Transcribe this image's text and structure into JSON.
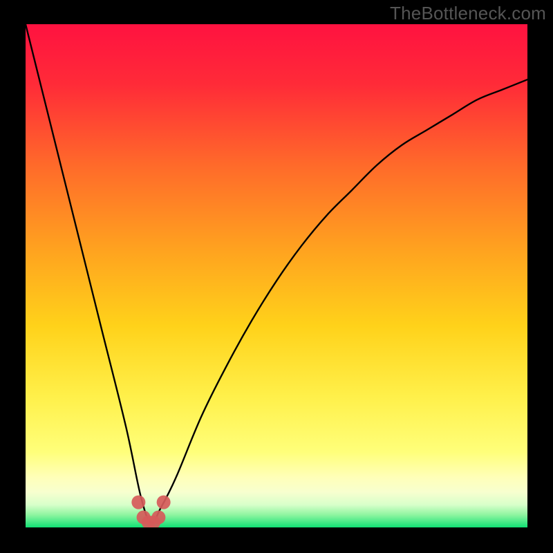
{
  "watermark": "TheBottleneck.com",
  "colors": {
    "page_bg": "#000000",
    "gradient_top": "#ff1240",
    "gradient_mid_upper": "#ff6a2a",
    "gradient_mid": "#ffc41a",
    "gradient_mid_lower": "#fff04a",
    "gradient_band_light": "#ffffb0",
    "gradient_bottom": "#10e074",
    "curve": "#000000",
    "marker": "#d65a5a"
  },
  "chart_data": {
    "type": "line",
    "title": "",
    "xlabel": "",
    "ylabel": "",
    "xlim": [
      0,
      100
    ],
    "ylim": [
      0,
      100
    ],
    "background": "rainbow-gradient vertical (red top to green bottom)",
    "series": [
      {
        "name": "bottleneck-curve",
        "x": [
          0,
          5,
          10,
          15,
          20,
          23,
          25,
          27,
          30,
          35,
          40,
          45,
          50,
          55,
          60,
          65,
          70,
          75,
          80,
          85,
          90,
          95,
          100
        ],
        "values": [
          100,
          80,
          60,
          40,
          20,
          6,
          1,
          4,
          10,
          22,
          32,
          41,
          49,
          56,
          62,
          67,
          72,
          76,
          79,
          82,
          85,
          87,
          89
        ]
      }
    ],
    "markers": {
      "name": "minimum-region",
      "x": [
        22.5,
        23.5,
        24.5,
        25.5,
        26.5,
        27.5
      ],
      "values": [
        5,
        2,
        1,
        1,
        2,
        5
      ]
    },
    "notes": "V-shaped curve reaching minimum near x≈25; left branch nearly linear from (0,100) to minimum; right branch concave rising toward ≈89 at x=100. Six pink circular markers cluster at the curve minimum."
  }
}
